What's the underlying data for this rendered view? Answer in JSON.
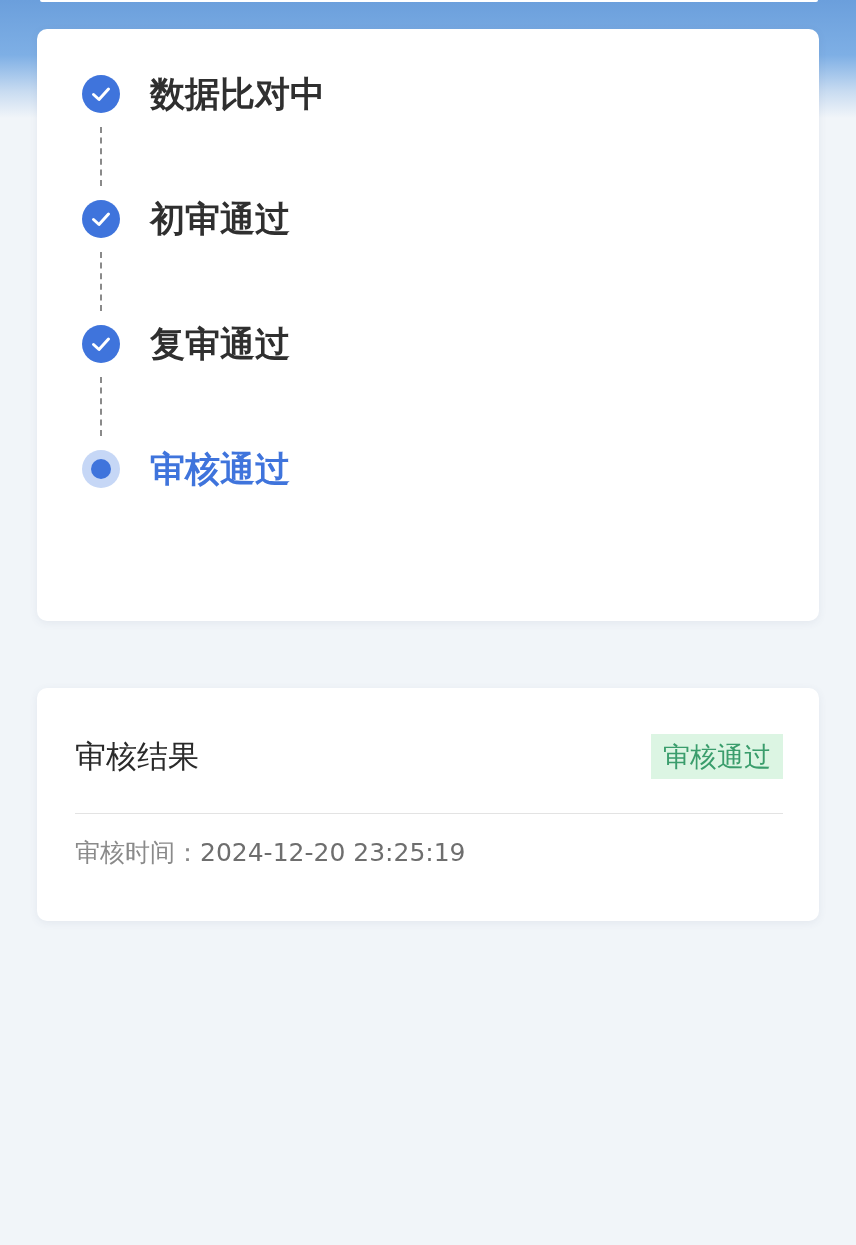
{
  "steps": [
    {
      "label": "数据比对中",
      "done": true
    },
    {
      "label": "初审通过",
      "done": true
    },
    {
      "label": "复审通过",
      "done": true
    },
    {
      "label": "审核通过",
      "done": false
    }
  ],
  "result": {
    "title": "审核结果",
    "badge": "审核通过",
    "time_label": "审核时间：",
    "time_value": "2024-12-20 23:25:19"
  }
}
